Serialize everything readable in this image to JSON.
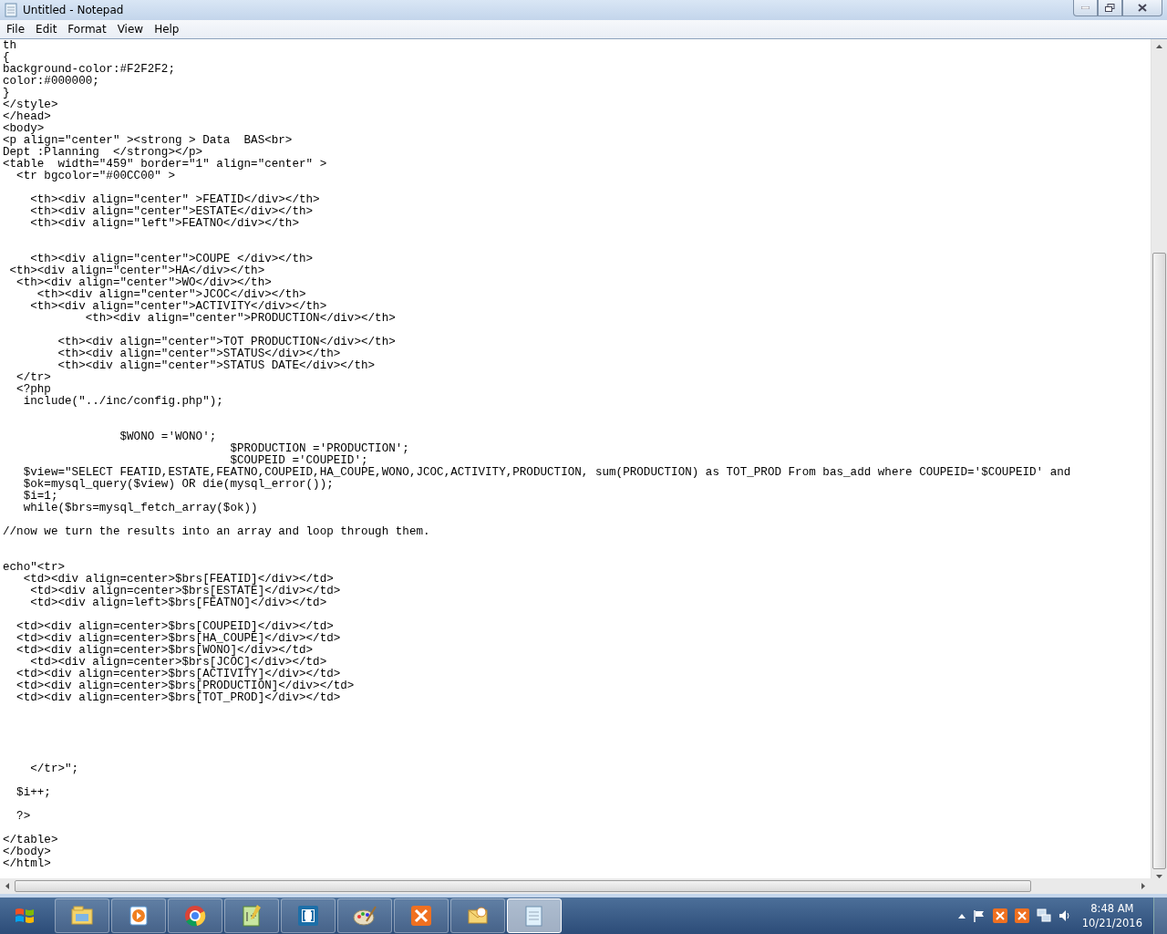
{
  "window": {
    "title": "Untitled - Notepad"
  },
  "menu": [
    "File",
    "Edit",
    "Format",
    "View",
    "Help"
  ],
  "lines": [
    {
      "kind": "code",
      "text": "th"
    },
    {
      "kind": "code",
      "text": "{"
    },
    {
      "kind": "code",
      "text": "background-color:#F2F2F2;"
    },
    {
      "kind": "code",
      "text": "color:#000000;"
    },
    {
      "kind": "code",
      "text": "}"
    },
    {
      "kind": "code",
      "text": "</style>"
    },
    {
      "kind": "code",
      "text": "</head>"
    },
    {
      "kind": "code",
      "text": "<body>"
    },
    {
      "kind": "code",
      "text": "<p align=\"center\" ><strong > Data  BAS<br>"
    },
    {
      "kind": "code",
      "text": "Dept :Planning  </strong></p>"
    },
    {
      "kind": "code",
      "text": "<table  width=\"459\" border=\"1\" align=\"center\" >"
    },
    {
      "kind": "code",
      "text": "  <tr bgcolor=\"#00CC00\" >"
    },
    {
      "kind": "blank"
    },
    {
      "kind": "code",
      "text": "    <th><div align=\"center\" >FEATID</div></th>"
    },
    {
      "kind": "code",
      "text": "    <th><div align=\"center\">ESTATE</div></th>"
    },
    {
      "kind": "code",
      "text": "    <th><div align=\"left\">FEATNO</div></th>"
    },
    {
      "kind": "blank"
    },
    {
      "kind": "blank"
    },
    {
      "kind": "code",
      "text": "    <th><div align=\"center\">COUPE </div></th>"
    },
    {
      "kind": "code",
      "text": " <th><div align=\"center\">HA</div></th>"
    },
    {
      "kind": "code",
      "text": "  <th><div align=\"center\">WO</div></th>"
    },
    {
      "kind": "code",
      "text": "     <th><div align=\"center\">JCOC</div></th>"
    },
    {
      "kind": "code",
      "text": "    <th><div align=\"center\">ACTIVITY</div></th>"
    },
    {
      "kind": "code",
      "text": "            <th><div align=\"center\">PRODUCTION</div></th>"
    },
    {
      "kind": "blank"
    },
    {
      "kind": "code",
      "text": "        <th><div align=\"center\">TOT PRODUCTION</div></th>"
    },
    {
      "kind": "code",
      "text": "        <th><div align=\"center\">STATUS</div></th>"
    },
    {
      "kind": "code",
      "text": "        <th><div align=\"center\">STATUS DATE</div></th>"
    },
    {
      "kind": "code",
      "text": "  </tr>"
    },
    {
      "kind": "code",
      "text": "  <?php"
    },
    {
      "kind": "code",
      "text": "   include(\"../inc/config.php\");"
    },
    {
      "kind": "blank"
    },
    {
      "kind": "blank"
    },
    {
      "kind": "code",
      "text": "                 $WONO ='WONO';"
    },
    {
      "kind": "code",
      "text": "                                 $PRODUCTION ='PRODUCTION';"
    },
    {
      "kind": "code",
      "text": "                                 $COUPEID ='COUPEID';"
    },
    {
      "kind": "code",
      "text": "   $view=\"SELECT FEATID,ESTATE,FEATNO,COUPEID,HA_COUPE,WONO,JCOC,ACTIVITY,PRODUCTION, sum(PRODUCTION) as TOT_PROD From bas_add where COUPEID='$COUPEID' and"
    },
    {
      "kind": "code",
      "text": "   $ok=mysql_query($view) OR die(mysql_error());"
    },
    {
      "kind": "code",
      "text": "   $i=1;"
    },
    {
      "kind": "code",
      "text": "   while($brs=mysql_fetch_array($ok))"
    },
    {
      "kind": "blank"
    },
    {
      "kind": "code",
      "text": "//now we turn the results into an array and loop through them."
    },
    {
      "kind": "blank"
    },
    {
      "kind": "blank"
    },
    {
      "kind": "code",
      "text": "echo\"<tr>"
    },
    {
      "kind": "code",
      "text": "   <td><div align=center>$brs[FEATID]</div></td>"
    },
    {
      "kind": "code",
      "text": "    <td><div align=center>$brs[ESTATE]</div></td>"
    },
    {
      "kind": "code",
      "text": "    <td><div align=left>$brs[FEATNO]</div></td>"
    },
    {
      "kind": "blank"
    },
    {
      "kind": "code",
      "text": "  <td><div align=center>$brs[COUPEID]</div></td>"
    },
    {
      "kind": "code",
      "text": "  <td><div align=center>$brs[HA_COUPE]</div></td>"
    },
    {
      "kind": "code",
      "text": "  <td><div align=center>$brs[WONO]</div></td>"
    },
    {
      "kind": "code",
      "text": "    <td><div align=center>$brs[JCOC]</div></td>"
    },
    {
      "kind": "code",
      "text": "  <td><div align=center>$brs[ACTIVITY]</div></td>"
    },
    {
      "kind": "code",
      "text": "  <td><div align=center>$brs[PRODUCTION]</div></td>"
    },
    {
      "kind": "code",
      "text": "  <td><div align=center>$brs[TOT_PROD]</div></td>"
    },
    {
      "kind": "blank"
    },
    {
      "kind": "blank"
    },
    {
      "kind": "blank"
    },
    {
      "kind": "blank"
    },
    {
      "kind": "blank"
    },
    {
      "kind": "code",
      "text": "    </tr>\";"
    },
    {
      "kind": "blank"
    },
    {
      "kind": "code",
      "text": "  $i++;"
    },
    {
      "kind": "blank"
    },
    {
      "kind": "code",
      "text": "  ?>"
    },
    {
      "kind": "blank"
    },
    {
      "kind": "code",
      "text": "</table>"
    },
    {
      "kind": "code",
      "text": "</body>"
    },
    {
      "kind": "code",
      "text": "</html>"
    }
  ],
  "taskbar": {
    "apps": [
      {
        "kind": "folder",
        "selected": false
      },
      {
        "kind": "media",
        "selected": false
      },
      {
        "kind": "browser",
        "selected": false
      },
      {
        "kind": "editor",
        "selected": false
      },
      {
        "kind": "brackets",
        "selected": false
      },
      {
        "kind": "paint",
        "selected": false
      },
      {
        "kind": "server",
        "selected": false
      },
      {
        "kind": "mail",
        "selected": false
      },
      {
        "kind": "notepad",
        "selected": true
      }
    ],
    "time": "8:48 AM",
    "date": "10/21/2016"
  }
}
